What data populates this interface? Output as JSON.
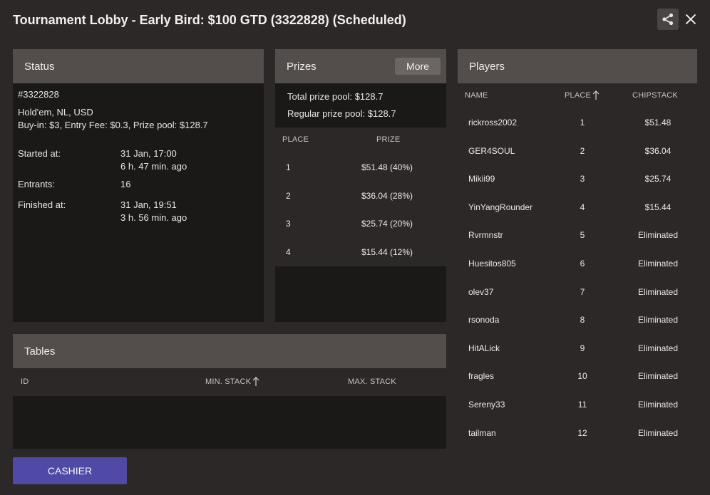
{
  "window": {
    "title": "Tournament Lobby - Early Bird: $100 GTD (3322828) (Scheduled)"
  },
  "status": {
    "header": "Status",
    "id": "#3322828",
    "game": "Hold'em, NL, USD",
    "buyin": "Buy-in: $3, Entry Fee: $0.3, Prize pool: $128.7",
    "started_label": "Started at:",
    "started_value": "31 Jan, 17:00",
    "started_ago": "6 h. 47 min. ago",
    "entrants_label": "Entrants:",
    "entrants_value": "16",
    "finished_label": "Finished at:",
    "finished_value": "31 Jan, 19:51",
    "finished_ago": "3 h. 56 min. ago"
  },
  "prizes": {
    "header": "Prizes",
    "more_label": "More",
    "total_label": "Total prize pool:",
    "total_value": "$128.7",
    "regular_label": "Regular prize pool:",
    "regular_value": "$128.7",
    "col_place": "PLACE",
    "col_prize": "PRIZE",
    "rows": [
      {
        "place": "1",
        "prize": "$51.48 (40%)"
      },
      {
        "place": "2",
        "prize": "$36.04 (28%)"
      },
      {
        "place": "3",
        "prize": "$25.74 (20%)"
      },
      {
        "place": "4",
        "prize": "$15.44 (12%)"
      }
    ]
  },
  "players": {
    "header": "Players",
    "col_name": "NAME",
    "col_place": "PLACE",
    "col_chipstack": "CHIPSTACK",
    "rows": [
      {
        "name": "rickross2002",
        "place": "1",
        "chips": "$51.48"
      },
      {
        "name": "GER4SOUL",
        "place": "2",
        "chips": "$36.04"
      },
      {
        "name": "Mikii99",
        "place": "3",
        "chips": "$25.74"
      },
      {
        "name": "YinYangRounder",
        "place": "4",
        "chips": "$15.44"
      },
      {
        "name": "Rvrmnstr",
        "place": "5",
        "chips": "Eliminated"
      },
      {
        "name": "Huesitos805",
        "place": "6",
        "chips": "Eliminated"
      },
      {
        "name": "olev37",
        "place": "7",
        "chips": "Eliminated"
      },
      {
        "name": "rsonoda",
        "place": "8",
        "chips": "Eliminated"
      },
      {
        "name": "HitALick",
        "place": "9",
        "chips": "Eliminated"
      },
      {
        "name": "fragles",
        "place": "10",
        "chips": "Eliminated"
      },
      {
        "name": "Sereny33",
        "place": "11",
        "chips": "Eliminated"
      },
      {
        "name": "tailman",
        "place": "12",
        "chips": "Eliminated"
      }
    ]
  },
  "tables": {
    "header": "Tables",
    "col_id": "ID",
    "col_min": "MIN. STACK",
    "col_max": "MAX. STACK"
  },
  "footer": {
    "cashier_label": "CASHIER"
  },
  "icons": {
    "share": "share-icon",
    "close": "close-icon",
    "sort": "sort-arrow-up-icon"
  }
}
